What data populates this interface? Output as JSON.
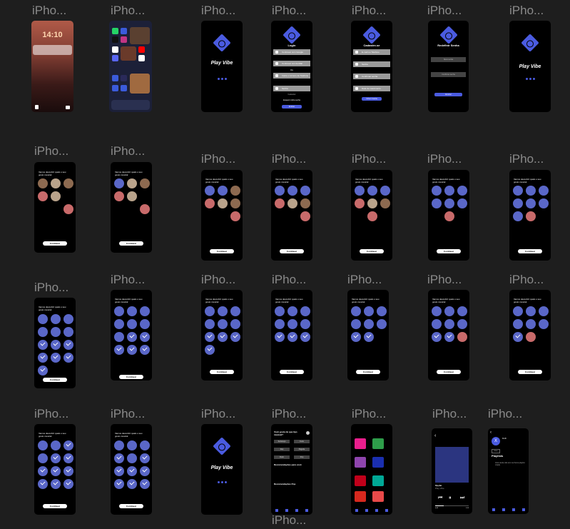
{
  "frame_label": "iPho...",
  "labels": [
    "iPho...",
    "iPho...",
    "iPho...",
    "iPho...",
    "iPho...",
    "iPho...",
    "iPho...",
    "iPho...",
    "iPho...",
    "iPho...",
    "iPho...",
    "iPho...",
    "iPho...",
    "iPho...",
    "iPho...",
    "iPho...",
    "iPho...",
    "iPho...",
    "iPho...",
    "iPho...",
    "iPho...",
    "iPho...",
    "iPho...",
    "iPho...",
    "iPho...",
    "iPho...",
    "iPho...",
    "iPho...",
    "iPho..."
  ],
  "lock": {
    "time": "14:10"
  },
  "splash": {
    "app_name": "Play Vibe"
  },
  "login": {
    "title": "Login",
    "google": "Continuar com Google",
    "email": "Continuar com E-Mail",
    "or": "Ou",
    "phone": "Insira o número de Telefone",
    "password": "Senha",
    "register": "Cadastrar",
    "forgot": "Esqueci minha senha",
    "submit": "Entrar"
  },
  "signup": {
    "title": "Cadastre-se",
    "email": "E-mail ou Telefone",
    "password": "Senha",
    "password_confirm": "Confirmar senha",
    "birthdate": "Data de nascimento",
    "submit": "Criar Conta"
  },
  "reset": {
    "title": "Redefinir Senha",
    "field1": "Nova senha",
    "field2": "Confirmar senha",
    "submit": "Enviar"
  },
  "artists": {
    "question": "Vamos descobrir quais o seu gosto musical",
    "continue": "Continuar"
  },
  "genres_screen": {
    "heading": "Você gosta de que tipo musical?",
    "genres": [
      "Sertanejo",
      "Funk",
      "Rap",
      "Pagode",
      "Rock",
      "Pop"
    ],
    "recs": "Recomendações para você",
    "recs2": "Recomendações Pop"
  },
  "player": {
    "song": "Opção",
    "artist": "Play Vibe",
    "elapsed": "0:48",
    "total": "3:19"
  },
  "profile": {
    "name": "Perfil",
    "btn": "Editar",
    "section": "Playlists",
    "empty": "Você ainda não tem nenhuma playlist criada"
  }
}
